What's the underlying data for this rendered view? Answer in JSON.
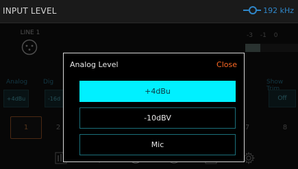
{
  "header": {
    "title": "INPUT LEVEL",
    "sample_rate": "192 kHz",
    "accent": "#2f86c8"
  },
  "background": {
    "line_label": "LINE 1",
    "meter_scale": [
      "-3",
      "-1",
      "0"
    ],
    "analog_label": "Analog",
    "digital_label": "Dig",
    "analog_value": "+4dBu",
    "digital_value": "-16d",
    "show_trim_label": "Show Trim",
    "show_trim_value": "Off",
    "channels": [
      "1",
      "2",
      "7",
      "8"
    ]
  },
  "bottom_nav": {
    "icons": [
      "meter-icon",
      "speaker-icon",
      "xlr-input-icon",
      "xlr-output-icon",
      "square-icon",
      "gear-icon"
    ]
  },
  "dialog": {
    "title": "Analog Level",
    "close_label": "Close",
    "close_color": "#ff6a24",
    "options": [
      {
        "label": "+4dBu",
        "selected": true
      },
      {
        "label": "-10dBV",
        "selected": false
      },
      {
        "label": "Mic",
        "selected": false
      }
    ],
    "selected_color": "#00f0ff"
  }
}
